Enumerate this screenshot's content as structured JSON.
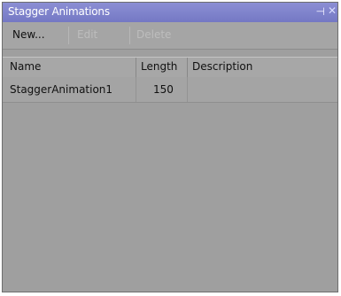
{
  "panel": {
    "title": "Stagger Animations",
    "pin_glyph": "⊣",
    "close_glyph": "✕"
  },
  "toolbar": {
    "new_label": "New...",
    "edit_label": "Edit",
    "delete_label": "Delete"
  },
  "table": {
    "columns": [
      "Name",
      "Length",
      "Description"
    ],
    "rows": [
      {
        "name": "StaggerAnimation1",
        "length": "150",
        "description": ""
      }
    ]
  }
}
